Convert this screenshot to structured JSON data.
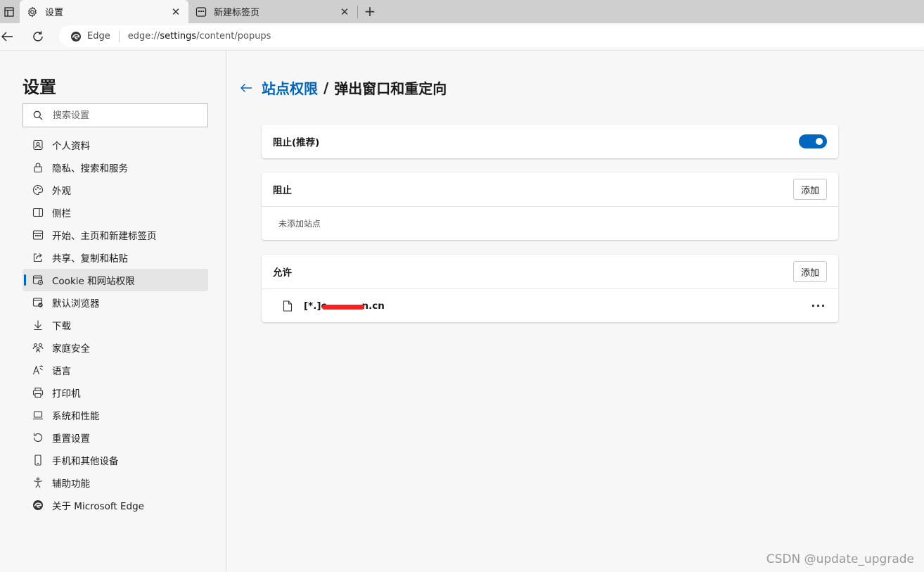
{
  "tabs": [
    {
      "title": "设置",
      "icon": "gear-icon"
    },
    {
      "title": "新建标签页",
      "icon": "newtab-icon"
    }
  ],
  "address": {
    "site_label": "Edge",
    "url_prefix": "edge://",
    "url_strong": "settings",
    "url_suffix": "/content/popups"
  },
  "sidebar": {
    "title": "设置",
    "search_placeholder": "搜索设置",
    "items": [
      {
        "label": "个人资料",
        "icon": "profile-icon"
      },
      {
        "label": "隐私、搜索和服务",
        "icon": "lock-icon"
      },
      {
        "label": "外观",
        "icon": "palette-icon"
      },
      {
        "label": "侧栏",
        "icon": "sidebar-icon"
      },
      {
        "label": "开始、主页和新建标签页",
        "icon": "home-icon"
      },
      {
        "label": "共享、复制和粘贴",
        "icon": "share-icon"
      },
      {
        "label": "Cookie 和网站权限",
        "icon": "cookie-icon",
        "active": true
      },
      {
        "label": "默认浏览器",
        "icon": "browser-icon"
      },
      {
        "label": "下载",
        "icon": "download-icon"
      },
      {
        "label": "家庭安全",
        "icon": "family-icon"
      },
      {
        "label": "语言",
        "icon": "language-icon"
      },
      {
        "label": "打印机",
        "icon": "printer-icon"
      },
      {
        "label": "系统和性能",
        "icon": "laptop-icon"
      },
      {
        "label": "重置设置",
        "icon": "reset-icon"
      },
      {
        "label": "手机和其他设备",
        "icon": "phone-icon"
      },
      {
        "label": "辅助功能",
        "icon": "accessibility-icon"
      },
      {
        "label": "关于 Microsoft Edge",
        "icon": "edge-logo-icon"
      }
    ]
  },
  "main": {
    "breadcrumb_parent": "站点权限",
    "breadcrumb_sep": "/",
    "breadcrumb_current": "弹出窗口和重定向",
    "block_toggle": {
      "label": "阻止(推荐)",
      "on": true
    },
    "block_section": {
      "title": "阻止",
      "add_label": "添加",
      "empty_text": "未添加站点"
    },
    "allow_section": {
      "title": "允许",
      "add_label": "添加",
      "site": "[*.]c         n.cn",
      "site_pre": "[*.]c",
      "site_post": "n.cn",
      "more_label": "···"
    }
  },
  "watermark": "CSDN @update_upgrade",
  "colors": {
    "accent": "#0067c0",
    "redaction": "#ff2020"
  }
}
